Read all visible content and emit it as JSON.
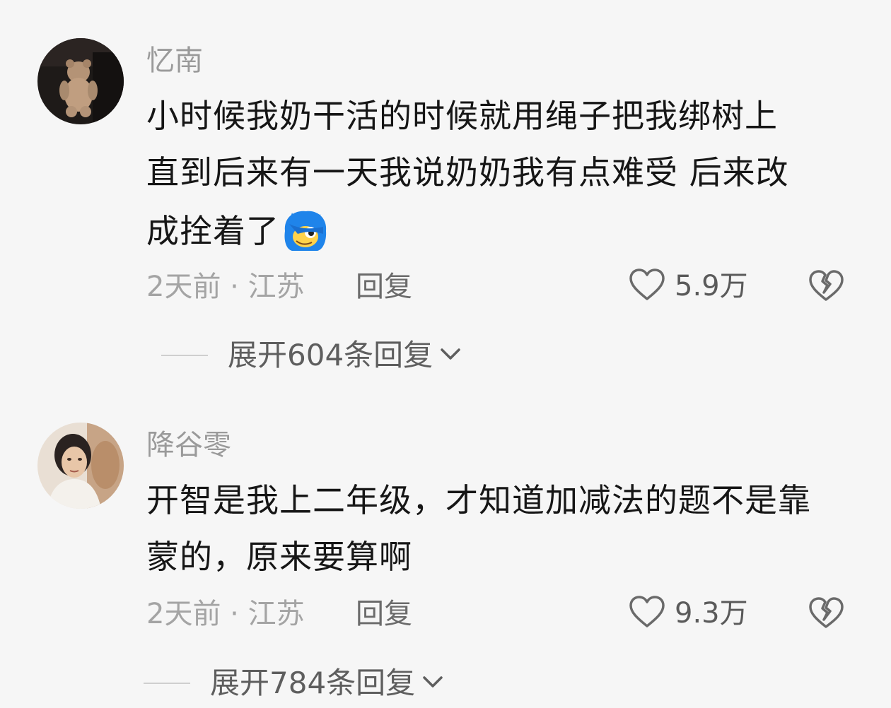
{
  "comments": [
    {
      "username": "忆南",
      "lines": [
        "小时候我奶干活的时候就用绳子把我绑树上",
        "直到后来有一天我说奶奶我有点难受 后来改",
        "成拴着了"
      ],
      "emoji_icon": "blue-hair-face-emoji",
      "meta": "2天前 · 江苏",
      "reply_label": "回复",
      "like_count": "5.9万",
      "expand_label": "展开604条回复"
    },
    {
      "username": "降谷零",
      "lines": [
        "开智是我上二年级，才知道加减法的题不是靠",
        "蒙的，原来要算啊"
      ],
      "meta": "2天前 · 江苏",
      "reply_label": "回复",
      "like_count": "9.3万",
      "expand_label": "展开784条回复"
    }
  ],
  "icons": {
    "like": "heart-outline-icon",
    "dislike": "broken-heart-icon",
    "expand": "chevron-down-icon"
  },
  "colors": {
    "background": "#f6f6f6",
    "username": "#9a9a9a",
    "body_text": "#161616",
    "meta_text": "#a4a4a4"
  }
}
